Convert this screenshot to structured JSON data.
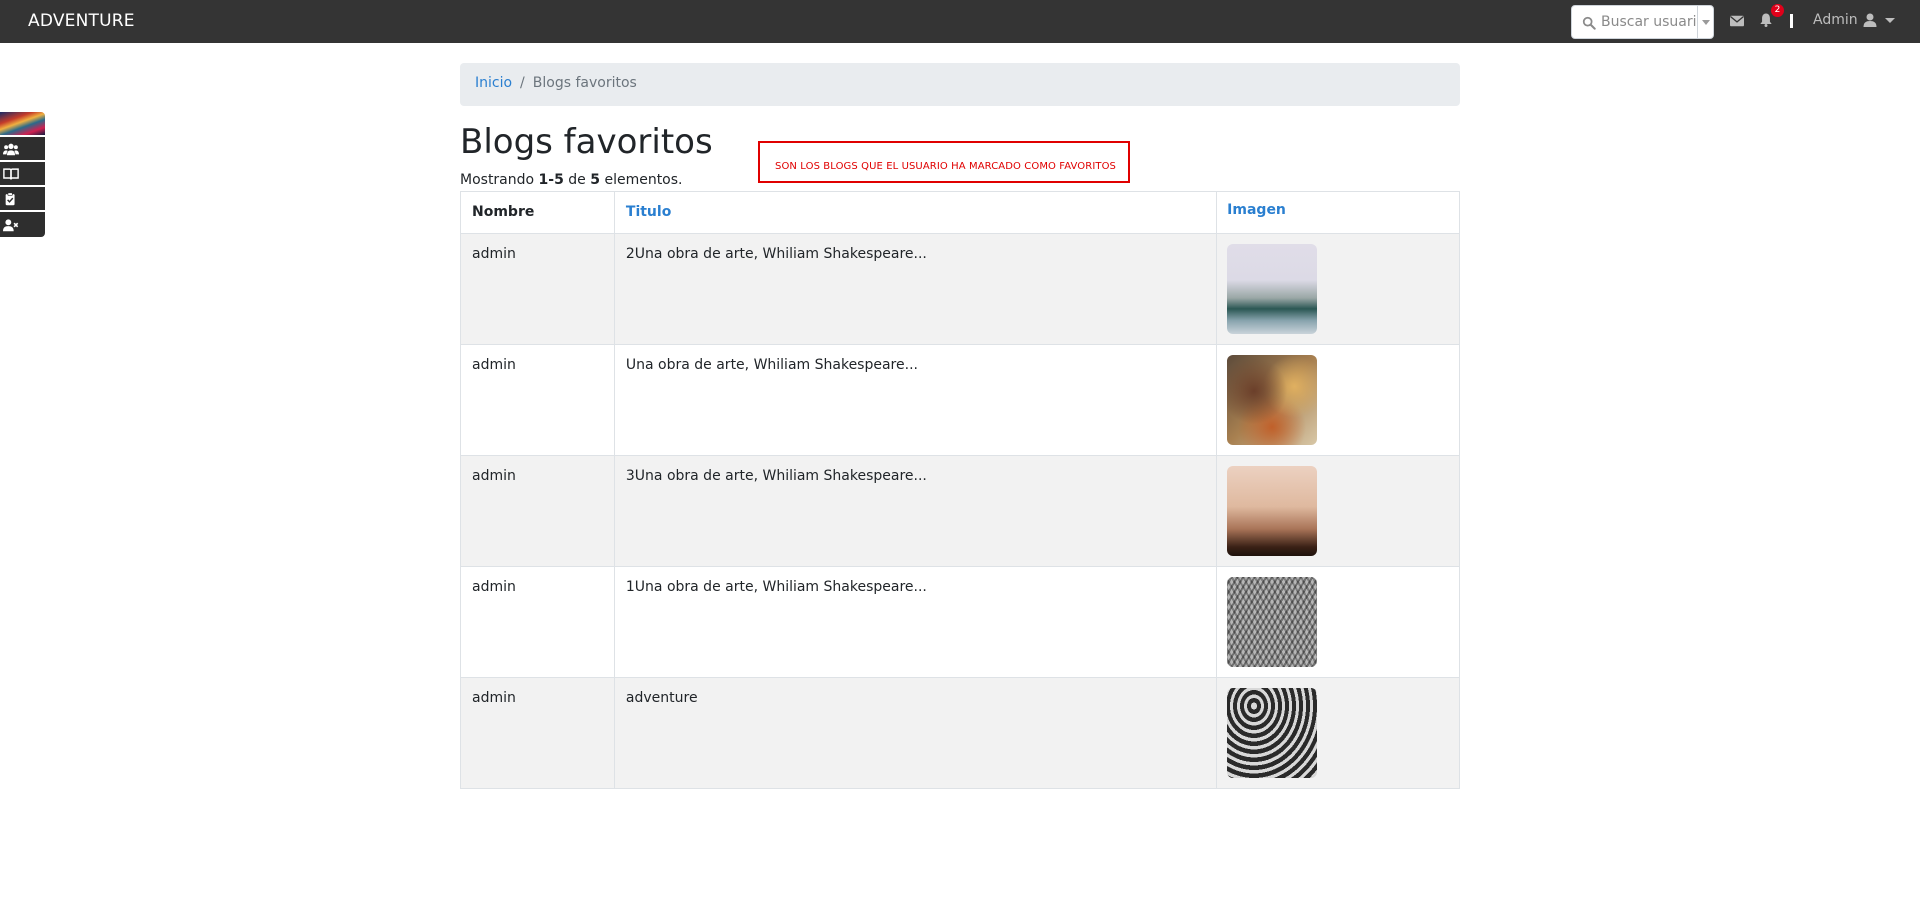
{
  "navbar": {
    "brand": "ADVENTURE",
    "search": {
      "placeholder": "Buscar usuario"
    },
    "notifications_count": "2",
    "user_label": "Admin"
  },
  "side_dock": {
    "icons": [
      "users-icon",
      "book-open-icon",
      "clipboard-check-icon",
      "user-times-icon"
    ]
  },
  "breadcrumb": {
    "home": "Inicio",
    "current": "Blogs favoritos"
  },
  "page": {
    "title": "Blogs favoritos",
    "summary_prefix": "Mostrando ",
    "summary_range": "1-5",
    "summary_mid": " de ",
    "summary_total": "5",
    "summary_suffix": " elementos.",
    "note": "SON LOS BLOGS QUE EL USUARIO HA MARCADO COMO FAVORITOS"
  },
  "table": {
    "headers": {
      "nombre": "Nombre",
      "titulo": "Titulo",
      "imagen": "Imagen"
    },
    "rows": [
      {
        "nombre": "admin",
        "titulo": "2Una obra de arte, Whiliam Shakespeare..."
      },
      {
        "nombre": "admin",
        "titulo": "Una obra de arte, Whiliam Shakespeare..."
      },
      {
        "nombre": "admin",
        "titulo": "3Una obra de arte, Whiliam Shakespeare..."
      },
      {
        "nombre": "admin",
        "titulo": "1Una obra de arte, Whiliam Shakespeare..."
      },
      {
        "nombre": "admin",
        "titulo": "adventure"
      }
    ]
  },
  "colors": {
    "navbar_bg": "#343434",
    "link": "#2a7fd0",
    "note_border": "#e00000",
    "badge": "#e0001a"
  }
}
